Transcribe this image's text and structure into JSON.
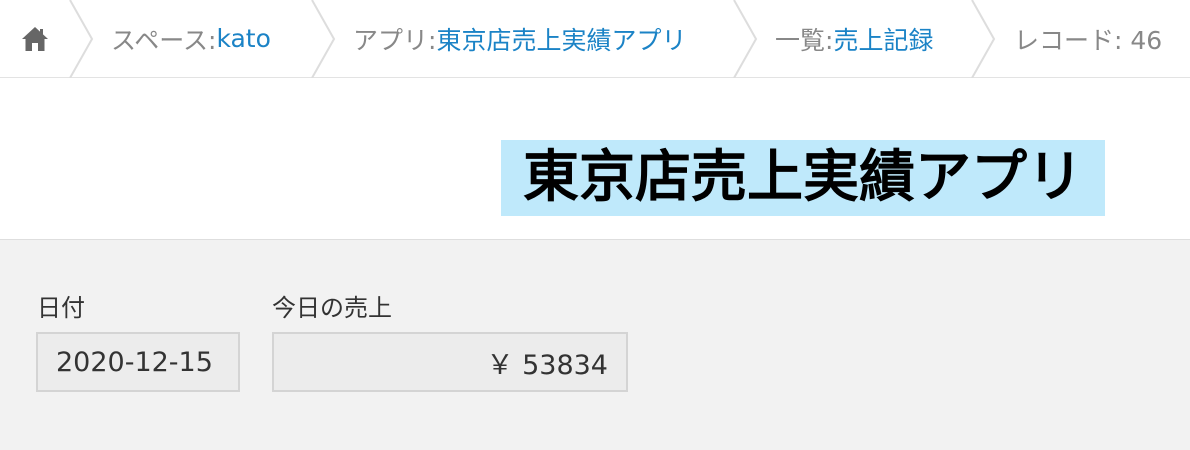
{
  "breadcrumb": {
    "space_prefix": "スペース: ",
    "space_name": "kato",
    "app_prefix": "アプリ: ",
    "app_name": "東京店売上実績アプリ",
    "view_prefix": "一覧: ",
    "view_name": "売上記録",
    "record_label": "レコード: 46"
  },
  "page": {
    "title": "東京店売上実績アプリ"
  },
  "fields": {
    "date": {
      "label": "日付",
      "value": "2020-12-15"
    },
    "sales": {
      "label": "今日の売上",
      "value": "￥ 53834"
    }
  },
  "colors": {
    "link": "#1b83c6",
    "title_highlight": "#bfe9fb"
  },
  "icons": {
    "home": "home-icon",
    "separator": "chevron-right-separator"
  }
}
